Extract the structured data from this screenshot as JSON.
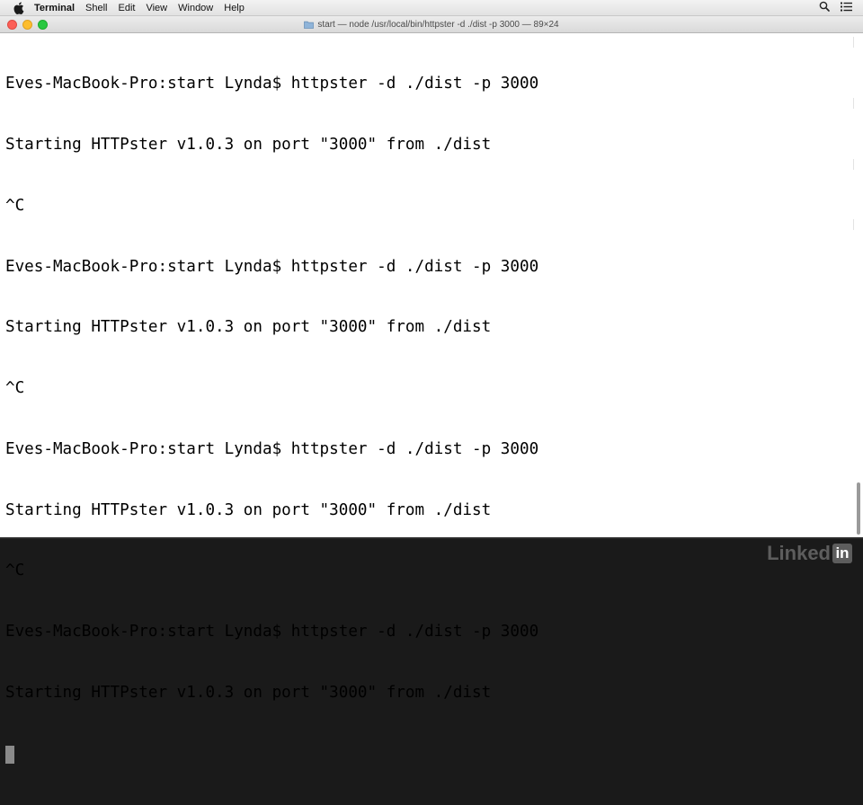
{
  "menubar": {
    "app_name": "Terminal",
    "items": [
      "Shell",
      "Edit",
      "View",
      "Window",
      "Help"
    ]
  },
  "window": {
    "title": "start — node /usr/local/bin/httpster -d ./dist -p 3000 — 89×24"
  },
  "terminal": {
    "lines": [
      "Eves-MacBook-Pro:start Lynda$ httpster -d ./dist -p 3000",
      "Starting HTTPster v1.0.3 on port \"3000\" from ./dist",
      "^C",
      "Eves-MacBook-Pro:start Lynda$ httpster -d ./dist -p 3000",
      "Starting HTTPster v1.0.3 on port \"3000\" from ./dist",
      "^C",
      "Eves-MacBook-Pro:start Lynda$ httpster -d ./dist -p 3000",
      "Starting HTTPster v1.0.3 on port \"3000\" from ./dist",
      "^C",
      "Eves-MacBook-Pro:start Lynda$ httpster -d ./dist -p 3000",
      "Starting HTTPster v1.0.3 on port \"3000\" from ./dist"
    ]
  },
  "watermark": {
    "brand_text": "Linked",
    "brand_box": "in"
  },
  "icons": {
    "apple": "apple-icon",
    "search": "search-icon",
    "list": "list-icon",
    "folder": "folder-icon"
  },
  "colors": {
    "close": "#fc5f57",
    "minimize": "#fdbd2e",
    "maximize": "#28c840",
    "terminal_bg": "#ffffff",
    "terminal_text": "#000000"
  }
}
